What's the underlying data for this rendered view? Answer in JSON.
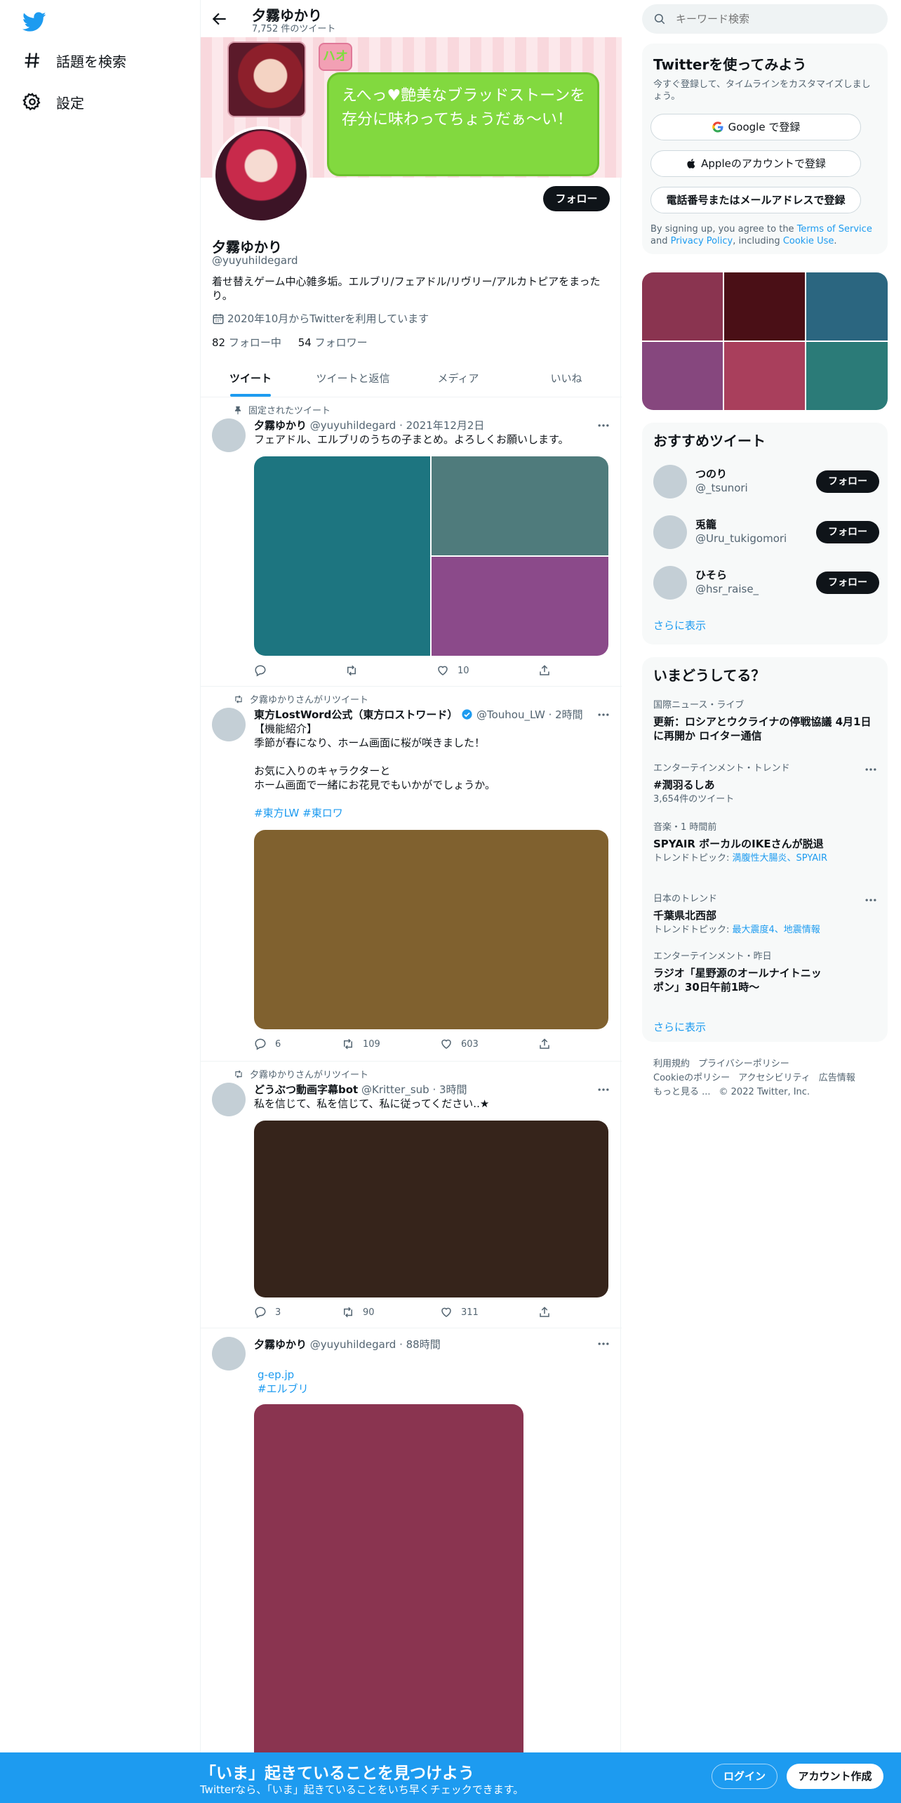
{
  "nav": {
    "items": [
      {
        "label": "話題を検索",
        "icon": "hashtag-icon"
      },
      {
        "label": "設定",
        "icon": "gear-icon"
      }
    ]
  },
  "header": {
    "name": "夕霧ゆかり",
    "tweet_count": "7,752 件のツイート"
  },
  "banner": {
    "badge": "ハオ",
    "bubble_text": "えへっ♥艶美なブラッドストーンを存分に味わってちょうだぁ〜い！"
  },
  "profile": {
    "follow_label": "フォロー",
    "name": "夕霧ゆかり",
    "handle": "@yuyuhildegard",
    "bio": "着せ替えゲーム中心雑多垢。エルブリ/フェアドル/リヴリー/アルカトピアをまったり。",
    "joined": "2020年10月からTwitterを利用しています",
    "following_count": "82",
    "following_label": "フォロー中",
    "followers_count": "54",
    "followers_label": "フォロワー"
  },
  "tabs": [
    "ツイート",
    "ツイートと返信",
    "メディア",
    "いいね"
  ],
  "tweets": [
    {
      "context": "固定されたツイート",
      "name": "夕霧ゆかり",
      "handle": "@yuyuhildegard",
      "time": "2021年12月2日",
      "text": "フェアドル、エルブリのうちの子まとめ。よろしくお願いします。",
      "media_colors": [
        "#1d7580",
        "#4f7b7c",
        "#8b4a8a"
      ],
      "replies": "",
      "retweets": "",
      "likes": "10"
    },
    {
      "context": "夕霧ゆかりさんがリツイート",
      "name": "東方LostWord公式（東方ロストワード）",
      "handle": "@Touhou_LW",
      "time": "2時間",
      "text": "【機能紹介】\n季節が春になり、ホーム画面に桜が咲きました！\n\nお気に入りのキャラクターと\nホーム画面で一緒にお花見でもいかがでしょうか。",
      "hashtags": "#東方LW #東ロワ",
      "media_colors": [
        "#80612f"
      ],
      "replies": "6",
      "retweets": "109",
      "likes": "603"
    },
    {
      "context": "夕霧ゆかりさんがリツイート",
      "name": "どうぶつ動画字幕bot",
      "handle": "@Kritter_sub",
      "time": "3時間",
      "text": "私を信じて、私を信じて、私に従ってください..★",
      "media_colors": [
        "#36241b"
      ],
      "replies": "3",
      "retweets": "90",
      "likes": "311"
    },
    {
      "context": "",
      "name": "夕霧ゆかり",
      "handle": "@yuyuhildegard",
      "time": "88時間",
      "link1": "g-ep.jp",
      "link2": "#エルブリ",
      "media_colors": [
        "#8a3450"
      ]
    }
  ],
  "right": {
    "search_placeholder": "キーワード検索",
    "signup": {
      "title": "Twitterを使ってみよう",
      "subtitle": "今すぐ登録して、タイムラインをカスタマイズしましょう。",
      "google": "Google で登録",
      "apple": "Appleのアカウントで登録",
      "phone": "電話番号またはメールアドレスで登録",
      "terms_1": "By signing up, you agree to the ",
      "terms_link1": "Terms of Service",
      "terms_2": " and ",
      "terms_link2": "Privacy Policy",
      "terms_3": ", including ",
      "terms_link3": "Cookie Use",
      "terms_4": "."
    },
    "photo_colors": [
      "#8a3450",
      "#4a0f16",
      "#2b6680",
      "#86477e",
      "#a93f5c",
      "#2b7b78"
    ],
    "recommend": {
      "title": "おすすめツイート",
      "users": [
        {
          "name": "つのり",
          "handle": "@_tsunori"
        },
        {
          "name": "兎籠",
          "handle": "@Uru_tukigomori"
        },
        {
          "name": "ひそら",
          "handle": "@hsr_raise_"
        }
      ],
      "follow_label": "フォロー",
      "more": "さらに表示"
    },
    "trends": {
      "title": "いまどうしてる？",
      "items": [
        {
          "meta": "国際ニュース・ライブ",
          "title": "更新：ロシアとウクライナの停戦協議 4月1日に再開か ロイター通信",
          "sub": ""
        },
        {
          "meta": "エンターテインメント・トレンド",
          "title": "#潤羽るしあ",
          "sub": "3,654件のツイート"
        },
        {
          "meta": "音楽・1 時間前",
          "title": "SPYAIR ボーカルのIKEさんが脱退",
          "sub_prefix": "トレンドトピック: ",
          "sub_links": "満腹性大腸炎、SPYAIR"
        },
        {
          "meta": "日本のトレンド",
          "title": "千葉県北西部",
          "sub_prefix": "トレンドトピック: ",
          "sub_links": "最大震度4、地震情報"
        },
        {
          "meta": "エンターテインメント・昨日",
          "title": "ラジオ「星野源のオールナイトニッポン」30日午前1時〜",
          "sub": ""
        }
      ],
      "more": "さらに表示"
    },
    "footer": {
      "l1": "利用規約",
      "l2": "プライバシーポリシー",
      "l3": "Cookieのポリシー",
      "l4": "アクセシビリティ",
      "l5": "広告情報",
      "l6": "もっと見る ...",
      "l7": "© 2022 Twitter, Inc."
    }
  },
  "bottombar": {
    "title": "「いま」起きていることを見つけよう",
    "subtitle": "Twitterなら、「いま」起きていることをいち早くチェックできます。",
    "login": "ログイン",
    "signup": "アカウント作成"
  },
  "colors": {
    "accent": "#1d9bf0",
    "text": "#0f1419",
    "muted": "#536471"
  }
}
